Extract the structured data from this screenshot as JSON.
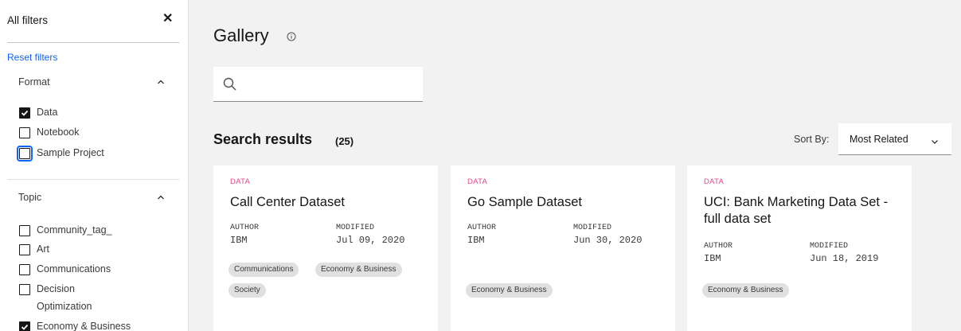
{
  "sidebar": {
    "title": "All filters",
    "close_glyph": "✕",
    "reset_label": "Reset filters",
    "format": {
      "title": "Format",
      "options": [
        {
          "label": "Data",
          "checked": true
        },
        {
          "label": "Notebook",
          "checked": false
        },
        {
          "label": "Sample Project",
          "checked": false
        }
      ]
    },
    "topic": {
      "title": "Topic",
      "options": [
        {
          "label": "Community_tag_",
          "checked": false
        },
        {
          "label": "Art",
          "checked": false
        },
        {
          "label": "Communications",
          "checked": false
        },
        {
          "label": "Decision",
          "label2": "Optimization",
          "checked": false
        },
        {
          "label": "Economy & Business",
          "checked": true
        }
      ]
    }
  },
  "main": {
    "title": "Gallery",
    "info_glyph": "ⓘ",
    "search": {
      "placeholder": "",
      "value": ""
    },
    "results_title": "Search results",
    "results_count": "(25)",
    "sort_label": "Sort By:",
    "sort_value": "Most Related",
    "author_label": "AUTHOR",
    "modified_label": "MODIFIED",
    "cards": [
      {
        "type": "DATA",
        "title": "Call Center Dataset",
        "author": "IBM",
        "modified": "Jul 09, 2020",
        "tags": [
          "Communications",
          "Economy & Business",
          "Society"
        ]
      },
      {
        "type": "DATA",
        "title": "Go Sample Dataset",
        "author": "IBM",
        "modified": "Jun 30, 2020",
        "tags": [
          "Economy & Business"
        ]
      },
      {
        "type": "DATA",
        "title": "UCI: Bank Marketing Data Set - full data set",
        "author": "IBM",
        "modified": "Jun 18, 2019",
        "tags": [
          "Economy & Business"
        ]
      }
    ]
  },
  "colors": {
    "accent_link": "#0f62fe",
    "card_type": "#e5478a",
    "tag_bg": "#e0e0e0",
    "page_bg": "#f2f2f2"
  }
}
